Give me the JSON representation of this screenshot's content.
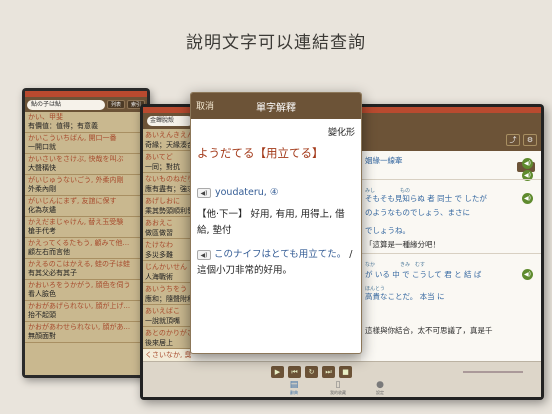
{
  "headline": "說明文字可以連結查詢",
  "back_device": {
    "search_value": "鮎の子は鮎",
    "btn1": "列表",
    "btn2": "索引",
    "rows": [
      {
        "kana": "かい、甲斐",
        "kanji": "有價值：值得；有意義"
      },
      {
        "kana": "かいこういちばん, 開口一番",
        "kanji": "一開口就"
      },
      {
        "kana": "かいさいをさけぶ, 快哉を叫ぶ",
        "kanji": "大聲稱快"
      },
      {
        "kana": "がいじゅうないごう, 外柔内剛",
        "kanji": "外柔內剛"
      },
      {
        "kana": "がいじんにまず, 友誼に保す",
        "kanji": "化為灰燼"
      },
      {
        "kana": "かえだまじゃけん, 替え玉受験",
        "kanji": "槍手代考"
      },
      {
        "kana": "かえってくるたもう, 顧みて他...",
        "kanji": "顧左右而言他"
      },
      {
        "kana": "かえるのこはかえる, 蛙の子は蛙",
        "kanji": "有其父必有其子"
      },
      {
        "kana": "かおいろをうかがう, 顔色を伺う",
        "kanji": "看人臉色"
      },
      {
        "kana": "かおがあげられない, 顔が上げ...",
        "kanji": "抬不起頭"
      },
      {
        "kana": "かおがあわせられない, 顔があ...",
        "kanji": "無顏面對"
      }
    ]
  },
  "mid_device": {
    "search_value": "金蟬脫殼",
    "rows": [
      {
        "k1": "あいえんきえん",
        "k2": "奇緣；天緣湊合"
      },
      {
        "k1": "あいてど",
        "k2": "一同；對抗"
      },
      {
        "k1": "ないものねだり",
        "k2": "應有盡有；強求"
      },
      {
        "k1": "あげしおに",
        "k2": "乘其勢頭順利發展"
      },
      {
        "k1": "あおえこ",
        "k2": "做區做習"
      },
      {
        "k1": "たけなわ",
        "k2": "多災多難"
      },
      {
        "k1": "じんかいせん",
        "k2": "人海戰術"
      },
      {
        "k1": "あいうちをう",
        "k2": "應和；隨聲附和"
      },
      {
        "k1": "あいえばこ",
        "k2": "一說就頂嘴"
      },
      {
        "k1": "あとのかりがさきに",
        "k2": "後來居上"
      },
      {
        "k1": "くさいなか, 臭い仲",
        "k2": ""
      }
    ],
    "examples": [
      {
        "jp": "姻緣一線牽",
        "zh": ""
      },
      {
        "jp": "そもそも見知らぬ 者 同士 で したが",
        "zh": "のようなものでしょう、まさに"
      },
      {
        "jp": "でしょうね。",
        "zh": "「這算是一種緣分吧！"
      },
      {
        "jp": "が いる 中 で こうして 君 と 結 ば",
        "zh": "高貴なことだ。 本当 に"
      },
      {
        "jp": "這樣與你結合，太不可思議了，真是千",
        "zh": ""
      }
    ]
  },
  "popup": {
    "cancel": "取消",
    "title": "單字解釋",
    "inflect": "變化形",
    "headword": "ようだてる【用立てる】",
    "pron": "youdateru, ④",
    "def": "【他·下一】 好用, 有用, 用得上, 借給, 墊付",
    "example_jp": "このナイフはとても用立てた。",
    "example_zh": "/ 這個小刀非常的好用。"
  },
  "tabs": [
    "辭典",
    "我的收藏",
    "設定"
  ]
}
